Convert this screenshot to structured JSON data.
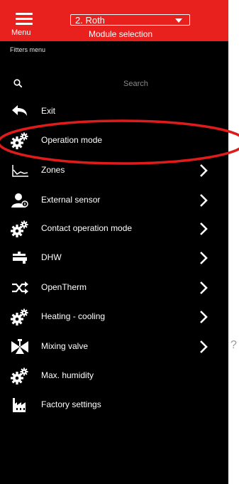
{
  "header": {
    "menu_label": "Menu",
    "module_value": "2. Roth",
    "module_label": "Module selection"
  },
  "breadcrumb": "Fitters menu",
  "search": {
    "placeholder": "Search"
  },
  "items": [
    {
      "label": "Exit",
      "icon": "back-arrow-icon",
      "chevron": false
    },
    {
      "label": "Operation mode",
      "icon": "gears-icon",
      "chevron": false
    },
    {
      "label": "Zones",
      "icon": "graph-icon",
      "chevron": true
    },
    {
      "label": "External sensor",
      "icon": "user-sensor-icon",
      "chevron": true
    },
    {
      "label": "Contact operation mode",
      "icon": "gears-icon",
      "chevron": true
    },
    {
      "label": "DHW",
      "icon": "faucet-icon",
      "chevron": true
    },
    {
      "label": "OpenTherm",
      "icon": "shuffle-icon",
      "chevron": true
    },
    {
      "label": "Heating - cooling",
      "icon": "gears-icon",
      "chevron": true
    },
    {
      "label": "Mixing valve",
      "icon": "valve-icon",
      "chevron": true
    },
    {
      "label": "Max. humidity",
      "icon": "gears-icon",
      "chevron": false
    },
    {
      "label": "Factory settings",
      "icon": "factory-icon",
      "chevron": false
    }
  ],
  "help_symbol": "?",
  "colors": {
    "header": "#e8211f",
    "background": "#000000",
    "highlight": "#e01b1b"
  }
}
